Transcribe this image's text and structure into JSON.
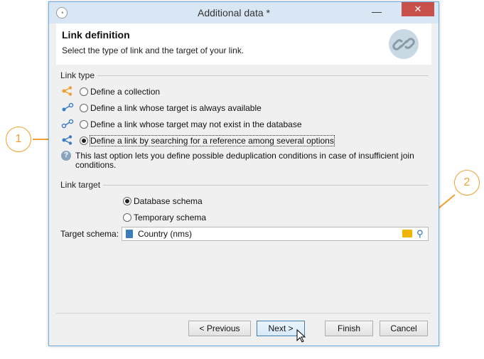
{
  "window": {
    "title": "Additional data *",
    "min_glyph": "—",
    "close_glyph": "✕"
  },
  "header": {
    "title": "Link definition",
    "subtitle": "Select the type of link and the target of your link."
  },
  "link_type": {
    "group_label": "Link type",
    "options": [
      {
        "label": "Define a collection",
        "checked": false
      },
      {
        "label": "Define a link whose target is always available",
        "checked": false
      },
      {
        "label": "Define a link whose target may not exist in the database",
        "checked": false
      },
      {
        "label": "Define a link by searching for a reference among several options",
        "checked": true
      }
    ],
    "info": "This last option lets you define possible deduplication conditions in case of insufficient join conditions."
  },
  "link_target": {
    "group_label": "Link target",
    "options": [
      {
        "label": "Database schema",
        "checked": true
      },
      {
        "label": "Temporary schema",
        "checked": false
      }
    ],
    "schema_label": "Target schema:",
    "schema_value": "Country (nms)"
  },
  "buttons": {
    "previous": "< Previous",
    "next": "Next >",
    "finish": "Finish",
    "cancel": "Cancel"
  },
  "callouts": {
    "one": "1",
    "two": "2"
  },
  "colors": {
    "accent": "#f0a030",
    "link_icon": "#3a7ec0",
    "title_bar": "#d9e6f3"
  },
  "icons": [
    "app-icon",
    "link-badge-icon",
    "collection-icon",
    "link-icon",
    "info-icon",
    "schema-doc-icon",
    "folder-icon",
    "search-icon",
    "mouse-pointer-icon"
  ]
}
